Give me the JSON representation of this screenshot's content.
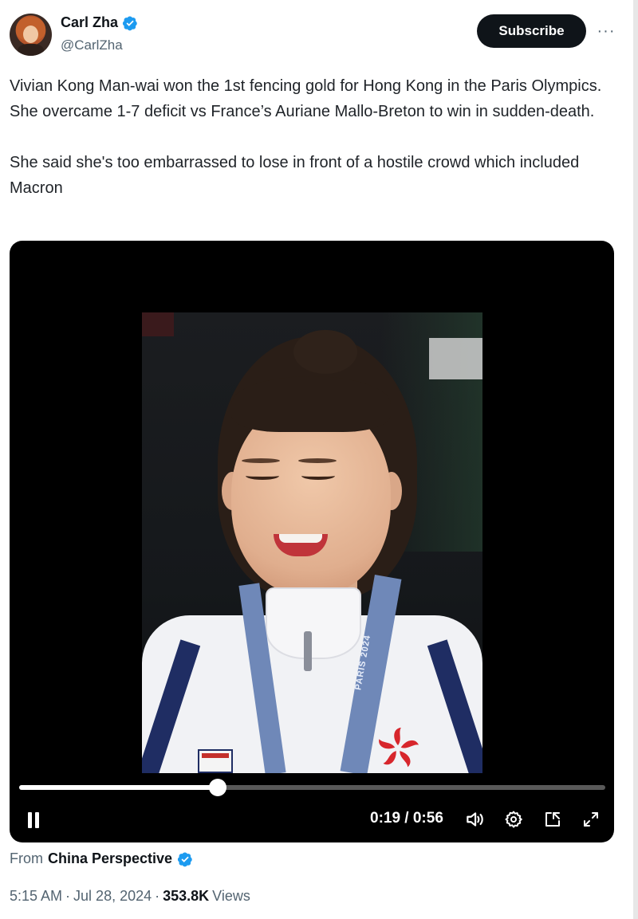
{
  "author": {
    "display_name": "Carl Zha",
    "handle": "@CarlZha",
    "verified_icon": "verified-badge-icon"
  },
  "header": {
    "subscribe_label": "Subscribe",
    "more_label": "···"
  },
  "tweet": {
    "paragraphs": [
      "Vivian Kong Man-wai won the 1st fencing gold for Hong Kong in the Paris Olympics. She overcame 1-7 deficit vs France’s Auriane Mallo-Breton to win in sudden-death.",
      "She said she's too embarrassed to lose in front of a hostile crowd which included Macron"
    ]
  },
  "video": {
    "medal_ribbon_text": "PARIS 2024",
    "progress_fraction": 0.339,
    "time_display": "0:19 / 0:56",
    "controls": [
      "pause-icon",
      "volume-icon",
      "settings-gear-icon",
      "picture-in-picture-icon",
      "fullscreen-icon"
    ]
  },
  "source": {
    "from_label": "From",
    "name": "China Perspective"
  },
  "meta": {
    "time": "5:15 AM",
    "separator": "·",
    "date": "Jul 28, 2024",
    "views_count": "353.8K",
    "views_label": "Views"
  },
  "colors": {
    "verified_blue": "#1d9bf0",
    "text_primary": "#0f1419",
    "text_secondary": "#536471",
    "subscribe_bg": "#0f1419"
  }
}
